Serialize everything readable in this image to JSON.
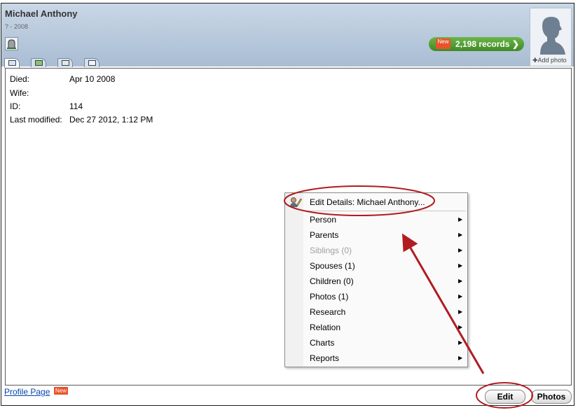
{
  "person": {
    "name": "Michael Anthony",
    "years": "? - 2008"
  },
  "records": {
    "badge": "New",
    "label": "2,198 records",
    "chevron": "❯"
  },
  "photo": {
    "add_label": "✚Add photo"
  },
  "tabs": [
    {
      "icon": "details-card-icon"
    },
    {
      "icon": "family-view-icon"
    },
    {
      "icon": "house-icon"
    },
    {
      "icon": "calendar-icon"
    }
  ],
  "details": [
    {
      "label": "Died:",
      "value": "Apr 10 2008"
    },
    {
      "label": "Wife:",
      "value": ""
    },
    {
      "label": "ID:",
      "value": "114"
    },
    {
      "label": "Last modified:",
      "value": "Dec 27 2012, 1:12 PM"
    }
  ],
  "menu": {
    "header_item": "Edit Details: Michael Anthony...",
    "items": [
      {
        "label": "Person",
        "disabled": false
      },
      {
        "label": "Parents",
        "disabled": false
      },
      {
        "label": "Siblings (0)",
        "disabled": true
      },
      {
        "label": "Spouses (1)",
        "disabled": false
      },
      {
        "label": "Children (0)",
        "disabled": false
      },
      {
        "label": "Photos (1)",
        "disabled": false
      },
      {
        "label": "Research",
        "disabled": false
      },
      {
        "label": "Relation",
        "disabled": false
      },
      {
        "label": "Charts",
        "disabled": false
      },
      {
        "label": "Reports",
        "disabled": false
      }
    ],
    "arrow": "▶"
  },
  "footer": {
    "profile_link": "Profile Page",
    "new_badge": "New",
    "edit_label": "Edit",
    "photos_label": "Photos"
  },
  "colors": {
    "annotation": "#b01c22",
    "records_green": "#4c9a2e",
    "header_blue": "#b8c9dc"
  }
}
